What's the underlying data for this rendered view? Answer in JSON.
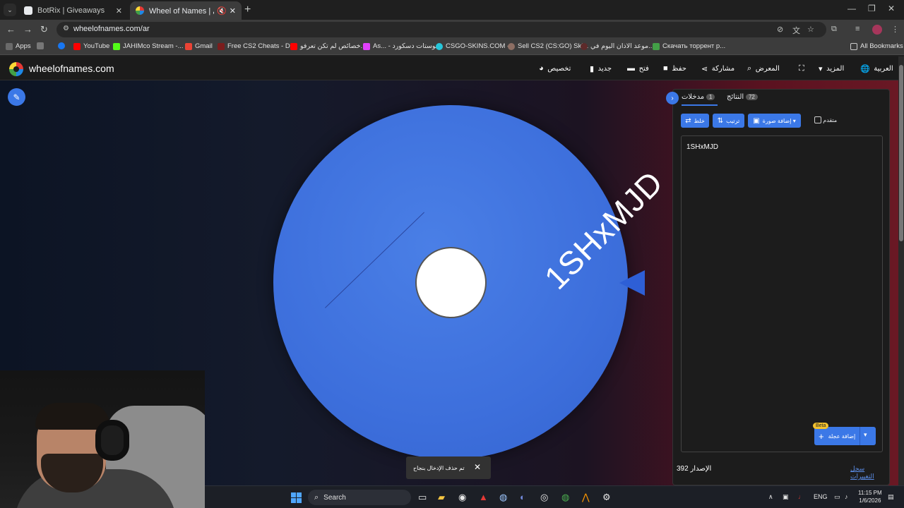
{
  "browser": {
    "tabs": [
      {
        "title": "BotRix | Giveaways",
        "color": "#e8eaed"
      },
      {
        "title": "Wheel of Names | العشوائي",
        "color": "#e53935"
      }
    ],
    "url": "wheelofnames.com/ar",
    "bookmarks": [
      "Apps",
      "YouTube",
      "JAHIMco Stream -...",
      "Gmail",
      "Free CS2 Cheats - D...",
      "خصائص لم تكن تعرفو...",
      "As... - بوستات دسكورد",
      "CSGO-SKINS.COM -...",
      "Sell CS2 (CS:GO) Ski...",
      "موعد الاذان اليوم في...",
      "Скачать торрент р...",
      "All Bookmarks"
    ]
  },
  "site": {
    "name": "wheelofnames.com",
    "menu": {
      "language": "العربية",
      "more": "المزيد",
      "gallery": "المعرض",
      "share": "مشاركة",
      "save": "حفظ",
      "open": "فتح",
      "new": "جديد",
      "customize": "تخصيص"
    }
  },
  "wheel": {
    "entry_label": "1SHxMJD",
    "color": "#3d6fdc"
  },
  "panel": {
    "tab_entries": "مدخلات",
    "tab_entries_count": "1",
    "tab_results": "النتائج",
    "tab_results_count": "72",
    "btn_shuffle": "خلط",
    "btn_sort": "ترتيب",
    "btn_add_image": "إضافة صورة",
    "advanced": "متقدم",
    "entries": [
      "1SHxMJD"
    ],
    "add_wheel": "إضافة عجلة",
    "beta": "Beta",
    "version_label": "الإصدار",
    "version": "392",
    "changelog": "سجل التغييرات"
  },
  "toast": {
    "message": "تم حذف الإدخال بنجاح"
  },
  "taskbar": {
    "search": "Search",
    "language": "ENG",
    "time": "11:15 PM",
    "date": "1/6/2026"
  }
}
